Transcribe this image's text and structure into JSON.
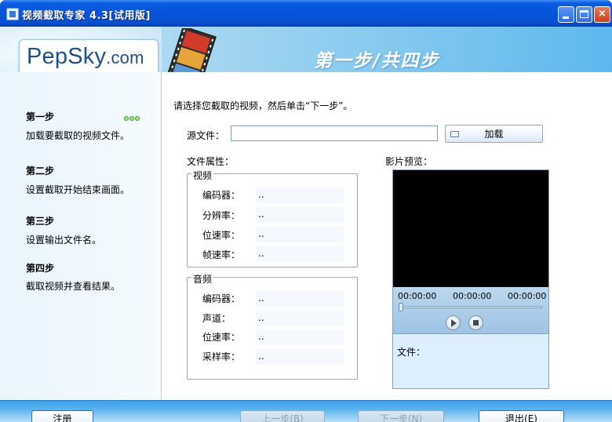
{
  "window": {
    "title": "视频截取专家 4.3[试用版]",
    "buttons": {
      "min": "minimize",
      "max": "maximize",
      "close": "×"
    }
  },
  "header": {
    "logo": "PepSky",
    "logo_suffix": ".com",
    "step_banner": "第一步/共四步"
  },
  "sidebar": {
    "steps": [
      {
        "title": "第一步",
        "desc": "加载要截取的视频文件。",
        "active": true
      },
      {
        "title": "第二步",
        "desc": "设置截取开始结束画面。",
        "active": false
      },
      {
        "title": "第三步",
        "desc": "设置输出文件名。",
        "active": false
      },
      {
        "title": "第四步",
        "desc": "截取视频并查看结果。",
        "active": false
      }
    ]
  },
  "main": {
    "instruction": "请选择您截取的视频，然后单击“下一步”。",
    "source_label": "源文件：",
    "source_value": "",
    "load_button": "加载",
    "props_label": "文件属性：",
    "video_group": {
      "legend": "视频",
      "rows": [
        {
          "label": "编码器：",
          "value": ".."
        },
        {
          "label": "分辨率：",
          "value": ".."
        },
        {
          "label": "位速率：",
          "value": ".."
        },
        {
          "label": "帧速率：",
          "value": ".."
        }
      ]
    },
    "audio_group": {
      "legend": "音频",
      "rows": [
        {
          "label": "编码器：",
          "value": ".."
        },
        {
          "label": "声道：",
          "value": ".."
        },
        {
          "label": "位速率：",
          "value": ".."
        },
        {
          "label": "采样率：",
          "value": ".."
        }
      ]
    },
    "preview": {
      "label": "影片预览：",
      "times": [
        "00:00:00",
        "00:00:00",
        "00:00:00"
      ],
      "seek_position": 0,
      "file_label": "文件："
    }
  },
  "footer": {
    "register": "注册",
    "prev": "上一步(B)",
    "next": "下一步(N)",
    "exit": "退出(E)"
  }
}
